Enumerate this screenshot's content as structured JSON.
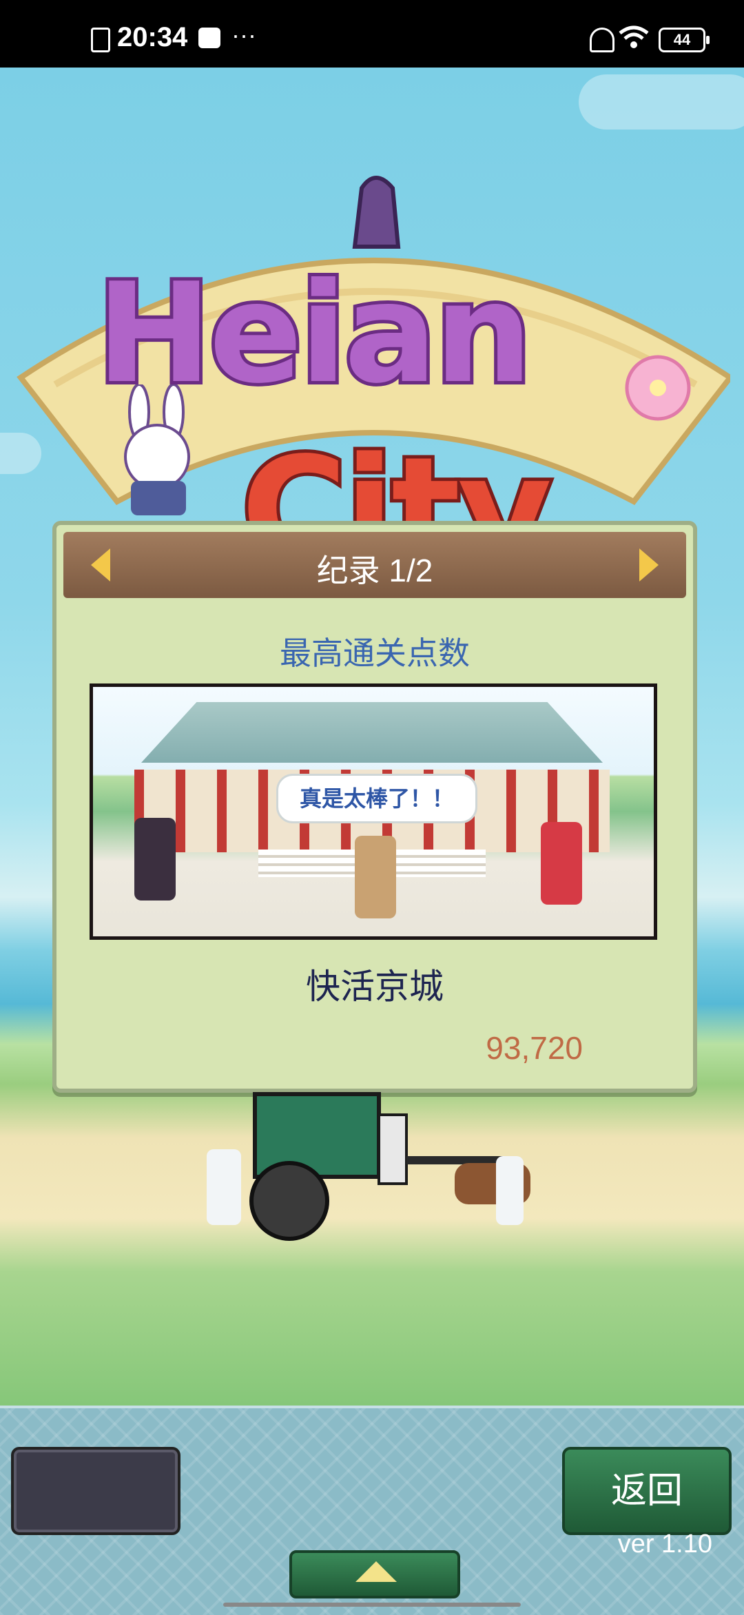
{
  "status_bar": {
    "time": "20:34",
    "battery": "44",
    "icons": [
      "sim-alert-icon",
      "message-icon",
      "more-dots-icon",
      "mute-icon",
      "wifi-icon",
      "battery-icon"
    ]
  },
  "logo": {
    "line1": "Heian",
    "line2": "City"
  },
  "record_panel": {
    "header_title": "纪录 1/2",
    "subtitle": "最高通关点数",
    "speech_bubble": "真是太棒了！！",
    "city_name": "快活京城",
    "score": "93,720"
  },
  "bottom_bar": {
    "back_label": "返回",
    "version": "ver 1.10"
  },
  "colors": {
    "panel_bg": "#d7e5b3",
    "header_bg": "#8b6a4f",
    "accent_green": "#2e7a4b",
    "subtitle_blue": "#3a66b0",
    "score_orange": "#c06a45"
  }
}
